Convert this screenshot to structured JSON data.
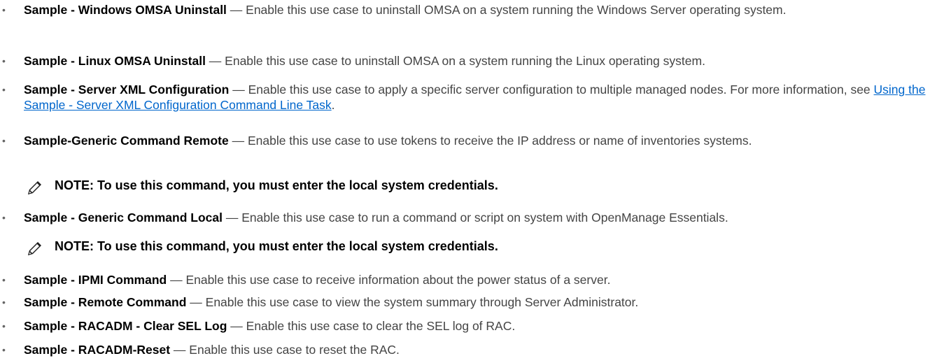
{
  "items": [
    {
      "term": "Sample - Windows OMSA Uninstall",
      "sep": " — ",
      "description": "Enable this use case to uninstall OMSA on a system running the Windows Server operating system."
    },
    {
      "term": "Sample - Linux OMSA Uninstall",
      "sep": " — ",
      "description": "Enable this use case to uninstall OMSA on a system running the Linux operating system."
    },
    {
      "term": "Sample - Server XML Configuration",
      "sep": " — ",
      "description": "Enable this use case to apply a specific server configuration to multiple managed nodes. For more information, see ",
      "link": "Using the Sample - Server XML Configuration Command Line Task",
      "after_link": "."
    },
    {
      "term": "Sample-Generic Command Remote",
      "sep": " — ",
      "description": "Enable this use case to use tokens to receive the IP address or name of inventories systems."
    },
    {
      "term": "Sample - Generic Command Local",
      "sep": " — ",
      "description": "Enable this use case to run a command or script on system with OpenManage Essentials."
    },
    {
      "term": "Sample - IPMI Command",
      "sep": " — ",
      "description": "Enable this use case to receive information about the power status of a server."
    },
    {
      "term": "Sample - Remote Command",
      "sep": " — ",
      "description": "Enable this use case to view the system summary through Server Administrator."
    },
    {
      "term": "Sample - RACADM - Clear SEL Log",
      "sep": " — ",
      "description": "Enable this use case to clear the SEL log of RAC."
    },
    {
      "term": "Sample - RACADM-Reset",
      "sep": " — ",
      "description": "Enable this use case to reset the RAC."
    }
  ],
  "bullet_char": "•",
  "notes": [
    {
      "icon": "pencil-note-icon",
      "text": "NOTE: To use this command, you must enter the local system credentials."
    },
    {
      "icon": "pencil-note-icon",
      "text": "NOTE: To use this command, you must enter the local system credentials."
    }
  ]
}
